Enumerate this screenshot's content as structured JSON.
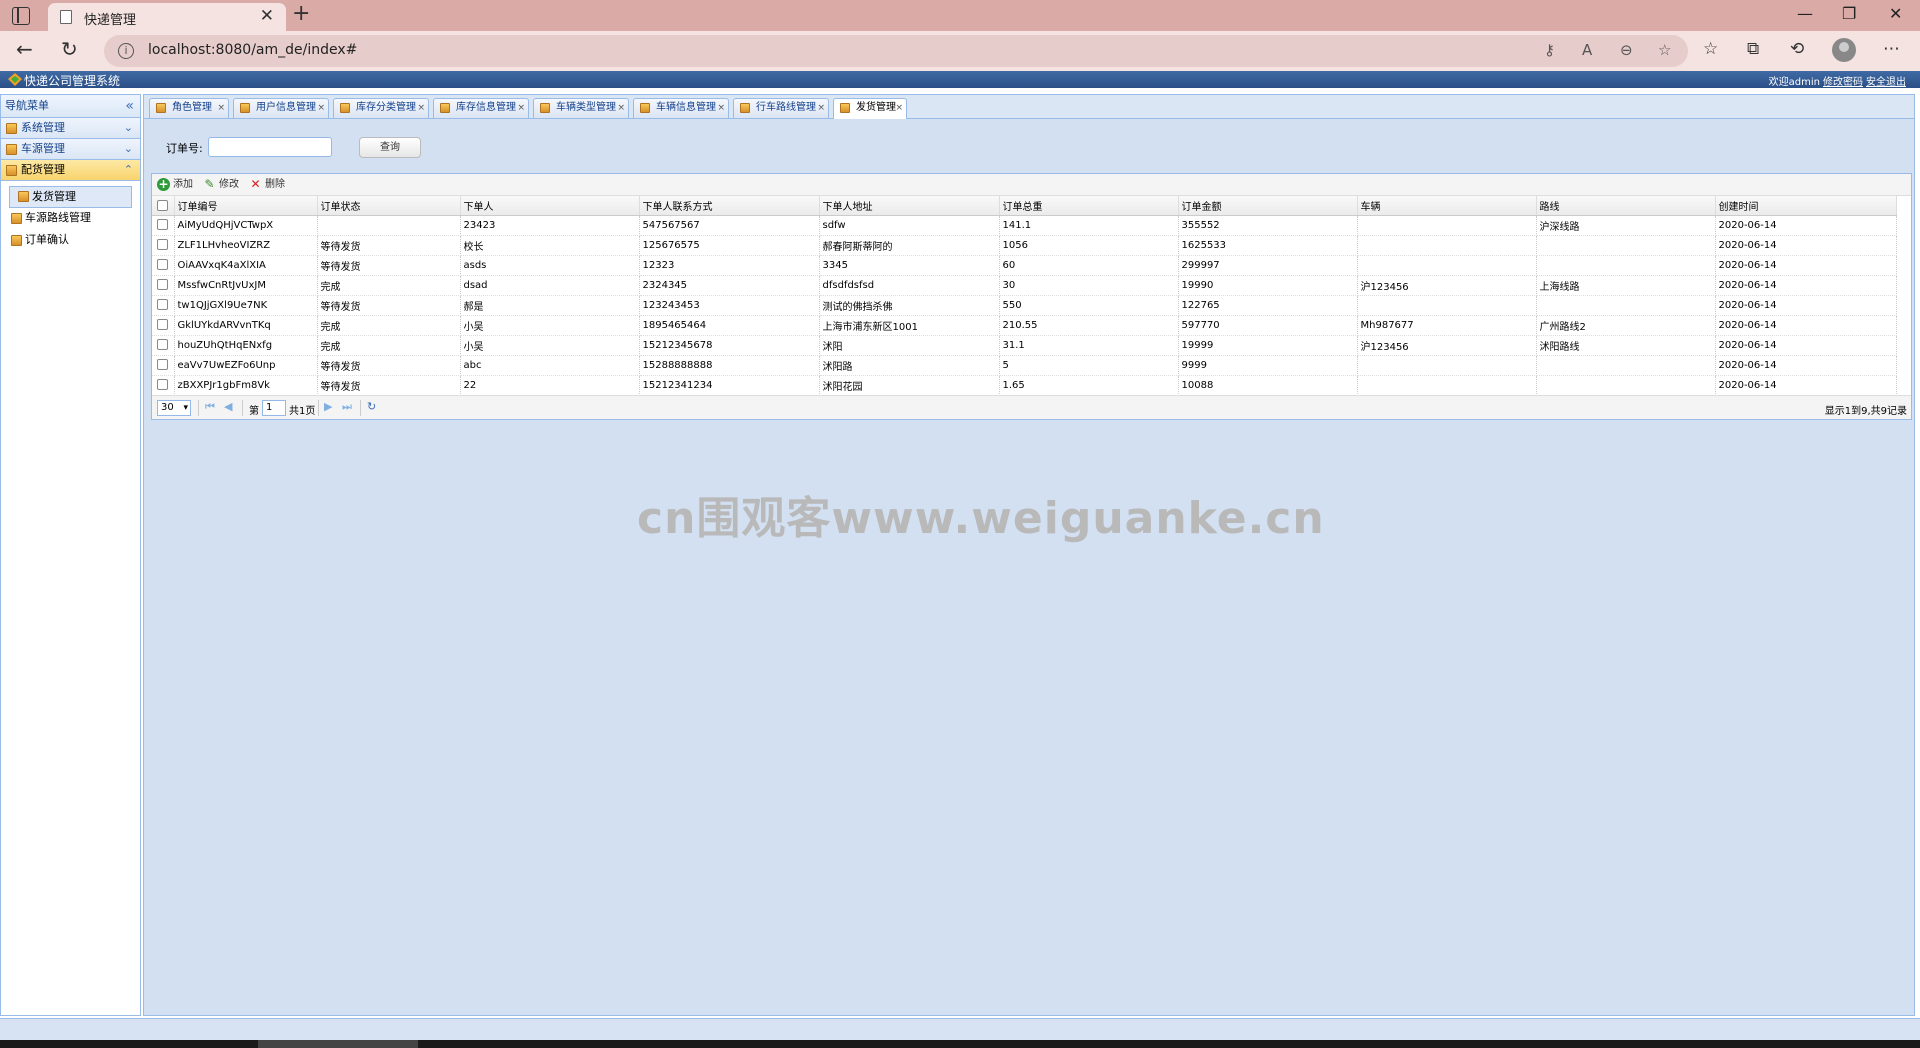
{
  "browser": {
    "tab_title": "快递管理",
    "url": "localhost:8080/am_de/index#",
    "tab_close": "✕",
    "new_tab": "+",
    "window_buttons": [
      "—",
      "❐",
      "✕"
    ]
  },
  "app": {
    "title": "快递公司管理系统",
    "welcome": "欢迎admin",
    "change_password": "修改密码",
    "logout": "安全退出"
  },
  "sidebar": {
    "header": "导航菜单",
    "sections": [
      {
        "label": "系统管理",
        "expanded": false
      },
      {
        "label": "车源管理",
        "expanded": false
      },
      {
        "label": "配货管理",
        "expanded": true
      }
    ],
    "tree_items": [
      "发货管理",
      "车源路线管理",
      "订单确认"
    ]
  },
  "tabs": [
    {
      "label": "角色管理"
    },
    {
      "label": "用户信息管理"
    },
    {
      "label": "库存分类管理"
    },
    {
      "label": "库存信息管理"
    },
    {
      "label": "车辆类型管理"
    },
    {
      "label": "车辆信息管理"
    },
    {
      "label": "行车路线管理"
    },
    {
      "label": "发货管理",
      "active": true
    }
  ],
  "search": {
    "label": "订单号:",
    "value": "",
    "button": "查询"
  },
  "grid_toolbar": {
    "add": "添加",
    "edit": "修改",
    "delete": "删除"
  },
  "table": {
    "columns": [
      "订单编号",
      "订单状态",
      "下单人",
      "下单人联系方式",
      "下单人地址",
      "订单总重",
      "订单金额",
      "车辆",
      "路线",
      "创建时间"
    ],
    "rows": [
      [
        "AiMyUdQHjVCTwpX",
        "",
        "23423",
        "547567567",
        "sdfw",
        "141.1",
        "355552",
        "",
        "沪深线路",
        "2020-06-14"
      ],
      [
        "ZLF1LHvheoVIZRZ",
        "等待发货",
        "校长",
        "125676575",
        "郝春阿斯蒂阿的",
        "1056",
        "1625533",
        "",
        "",
        "2020-06-14"
      ],
      [
        "OiAAVxqK4aXlXIA",
        "等待发货",
        "asds",
        "12323",
        "3345",
        "60",
        "299997",
        "",
        "",
        "2020-06-14"
      ],
      [
        "MssfwCnRtJvUxJM",
        "完成",
        "dsad",
        "2324345",
        "dfsdfdsfsd",
        "30",
        "19990",
        "沪123456",
        "上海线路",
        "2020-06-14"
      ],
      [
        "tw1QJjGXl9Ue7NK",
        "等待发货",
        "郝是",
        "123243453",
        "测试的佛挡杀佛",
        "550",
        "122765",
        "",
        "",
        "2020-06-14"
      ],
      [
        "GklUYkdARVvnTKq",
        "完成",
        "小吴",
        "1895465464",
        "上海市浦东新区1001",
        "210.55",
        "597770",
        "Mh987677",
        "广州路线2",
        "2020-06-14"
      ],
      [
        "houZUhQtHqENxfg",
        "完成",
        "小吴",
        "15212345678",
        "沭阳",
        "31.1",
        "19999",
        "沪123456",
        "沭阳路线",
        "2020-06-14"
      ],
      [
        "eaVv7UwEZFo6Unp",
        "等待发货",
        "abc",
        "15288888888",
        "沭阳路",
        "5",
        "9999",
        "",
        "",
        "2020-06-14"
      ],
      [
        "zBXXPJr1gbFm8Vk",
        "等待发货",
        "22",
        "15212341234",
        "沭阳花园",
        "1.65",
        "10088",
        "",
        "",
        "2020-06-14"
      ]
    ]
  },
  "pager": {
    "page_size": "30",
    "page_prefix": "第",
    "page_number": "1",
    "page_total": "共1页",
    "info": "显示1到9,共9记录"
  },
  "watermark": "cn围观客www.weiguanke.cn",
  "colors": {
    "tabstrip": "#d9aaa6",
    "header": "#2c5088",
    "panel_bg": "#d2e0f2",
    "border": "#99bbe8",
    "active_section": "#f8d36c"
  }
}
